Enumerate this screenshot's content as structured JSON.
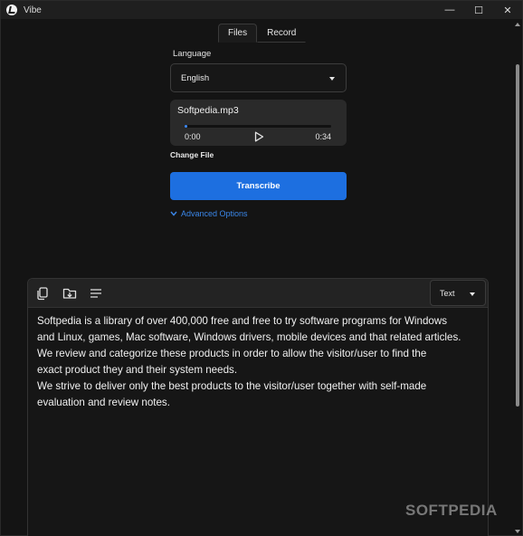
{
  "window": {
    "title": "Vibe",
    "controls": {
      "minimize": "—",
      "maximize": "☐",
      "close": "✕"
    }
  },
  "tabs": [
    {
      "label": "Files",
      "active": true
    },
    {
      "label": "Record",
      "active": false
    }
  ],
  "language": {
    "label": "Language",
    "selected": "English"
  },
  "player": {
    "file_name": "Softpedia.mp3",
    "current_time": "0:00",
    "total_time": "0:34",
    "progress_fraction": 0.02
  },
  "change_file_label": "Change File",
  "transcribe_label": "Transcribe",
  "advanced_options_label": "Advanced Options",
  "output": {
    "toolbar_icons": [
      "copy-icon",
      "download-icon",
      "list-icon"
    ],
    "format_selected": "Text",
    "lines": [
      "Softpedia is a library of over 400,000 free and free to try software programs for Windows",
      "and Linux, games, Mac software, Windows drivers, mobile devices and that related articles.",
      "We review and categorize these products in order to allow the visitor/user to find the",
      "exact product they and their system needs.",
      "We strive to deliver only the best products to the visitor/user together with self-made",
      "evaluation and review notes."
    ]
  },
  "watermark": "SOFTPEDIA",
  "colors": {
    "accent": "#1d6fe0",
    "link": "#3a86e8",
    "background": "#141414"
  }
}
